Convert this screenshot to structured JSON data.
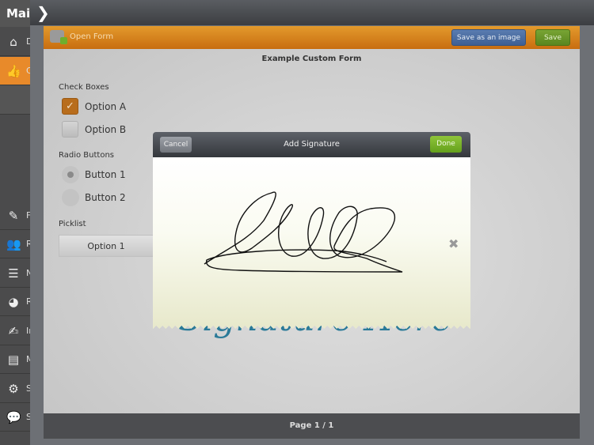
{
  "sidebar": {
    "title": "Main",
    "items": [
      {
        "icon": "home-icon",
        "label": "D"
      },
      {
        "icon": "thumbs-up-icon",
        "label": "C"
      },
      {
        "icon": "pencil-icon",
        "label": "F"
      },
      {
        "icon": "people-icon",
        "label": "R"
      },
      {
        "icon": "notepad-icon",
        "label": "N"
      },
      {
        "icon": "pie-chart-icon",
        "label": "R"
      },
      {
        "icon": "edit-icon",
        "label": "In"
      },
      {
        "icon": "inbox-icon",
        "label": "M"
      },
      {
        "icon": "gear-icon",
        "label": "S"
      },
      {
        "icon": "speech-bubble-icon",
        "label": "S"
      }
    ]
  },
  "header": {
    "open_form": "Open Form",
    "save_image": "Save as an image",
    "save": "Save"
  },
  "form": {
    "title": "Example Custom Form",
    "checkboxes_label": "Check Boxes",
    "option_a": "Option A",
    "option_a_checked": true,
    "option_b": "Option B",
    "option_b_checked": false,
    "radio_label": "Radio Buttons",
    "button1": "Button 1",
    "button2": "Button 2",
    "selected_radio": "Button 1",
    "picklist_label": "Picklist",
    "picklist_value": "Option 1",
    "signature_placeholder": "Signature Here"
  },
  "footer": {
    "page": "Page 1 / 1"
  },
  "dialog": {
    "cancel": "Cancel",
    "title": "Add Signature",
    "done": "Done",
    "clear_icon": "close-icon"
  },
  "colors": {
    "accent": "#e88a2a",
    "done": "#78b52c",
    "save_image": "#4e6fa3"
  }
}
